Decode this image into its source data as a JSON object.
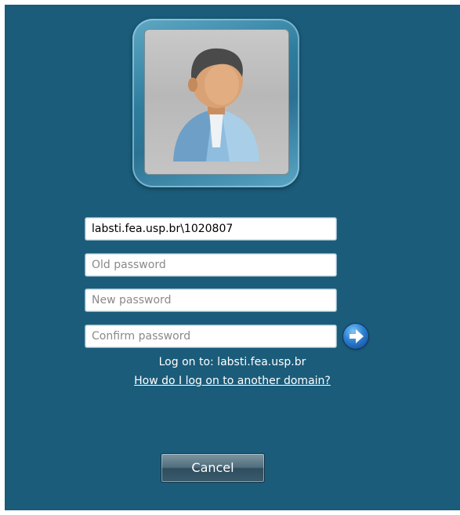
{
  "logon": {
    "username_value": "labsti.fea.usp.br\\1020807",
    "old_password_placeholder": "Old password",
    "new_password_placeholder": "New password",
    "confirm_password_placeholder": "Confirm password",
    "log_on_to_text": "Log on to: labsti.fea.usp.br",
    "other_domain_link": "How do I log on to another domain?",
    "cancel_label": "Cancel"
  },
  "icons": {
    "avatar": "user-avatar-icon",
    "submit": "arrow-right-icon"
  },
  "colors": {
    "background": "#1b5c7a",
    "text": "#ffffff"
  }
}
